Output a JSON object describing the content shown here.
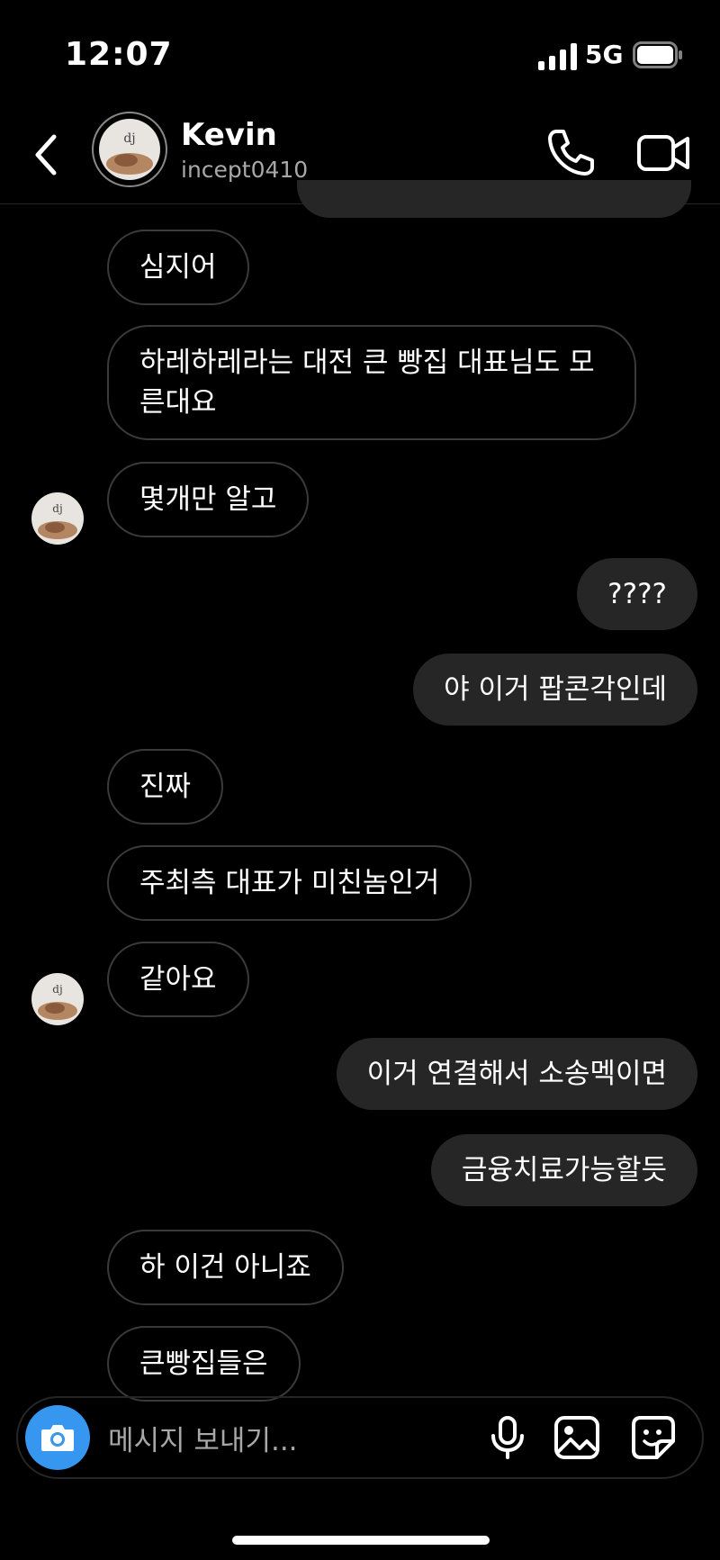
{
  "status": {
    "time": "12:07",
    "network": "5G"
  },
  "contact": {
    "name": "Kevin",
    "handle": "incept0410"
  },
  "messages": [
    {
      "text": "심지어"
    },
    {
      "line1": "하레하레라는 대전 큰 빵집 대표님도 모",
      "line2": "른대요"
    },
    {
      "text": "몇개만 알고"
    },
    {
      "text": "????"
    },
    {
      "text": "야 이거 팝콘각인데"
    },
    {
      "text": "진짜"
    },
    {
      "text": "주최측 대표가 미친놈인거"
    },
    {
      "text": "같아요"
    },
    {
      "text": "이거 연결해서 소송멕이면"
    },
    {
      "text": "금융치료가능할듯"
    },
    {
      "text": "하 이건 아니죠"
    },
    {
      "text": "큰빵집들은"
    }
  ],
  "composer": {
    "placeholder": "메시지 보내기..."
  },
  "icons": {
    "back": "chevron-left-icon",
    "call": "phone-icon",
    "video": "video-camera-icon",
    "camera": "camera-icon",
    "mic": "microphone-icon",
    "gallery": "image-icon",
    "sticker": "sticker-icon"
  },
  "colors": {
    "accent": "#3797f0",
    "outgoing_bubble": "#262626",
    "incoming_border": "#3a3a3a",
    "background": "#000000"
  }
}
